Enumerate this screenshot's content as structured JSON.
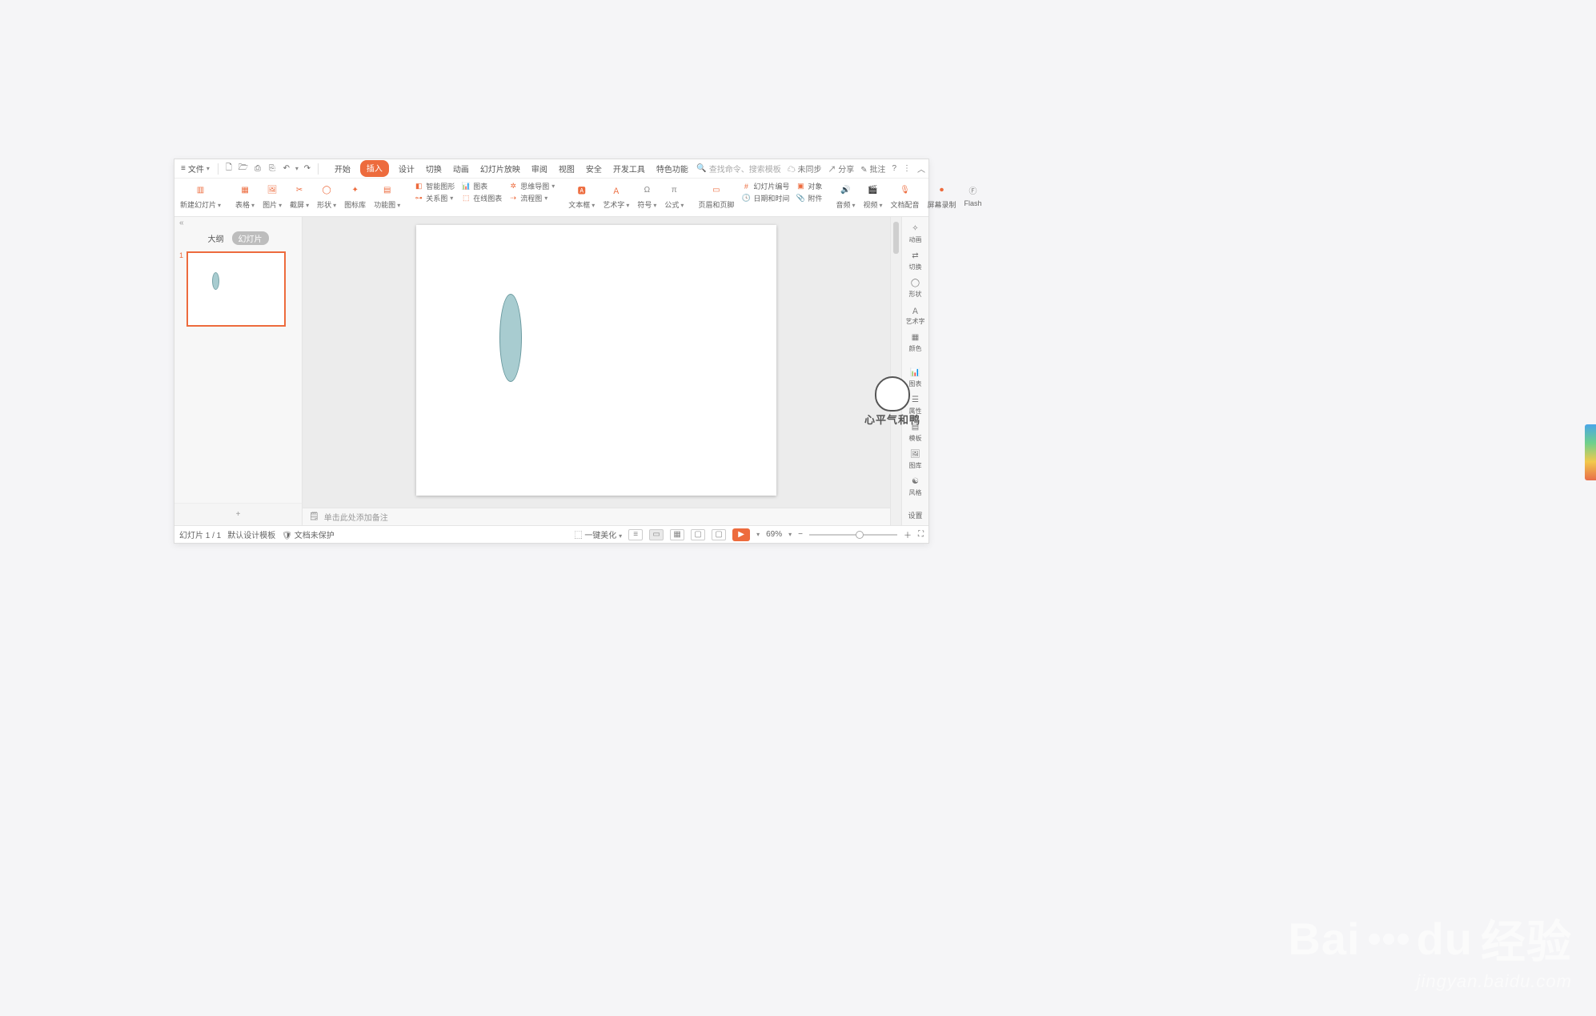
{
  "menu": {
    "file_label": "文件"
  },
  "quick_access": {
    "new": "新建",
    "open": "打开",
    "print": "打印",
    "save": "保存",
    "undo": "撤销",
    "redo": "重做"
  },
  "tabs": {
    "start": "开始",
    "insert": "插入",
    "design": "设计",
    "transition": "切换",
    "animation": "动画",
    "slideshow": "幻灯片放映",
    "review": "审阅",
    "view": "视图",
    "security": "安全",
    "devtools": "开发工具",
    "special": "特色功能"
  },
  "toolbar_right": {
    "search_placeholder": "查找命令、搜索模板",
    "unsynced": "未同步",
    "share": "分享",
    "annotate": "批注"
  },
  "ribbon": {
    "new_slide": "新建幻灯片",
    "table": "表格",
    "picture": "图片",
    "screenshot": "截屏",
    "shape": "形状",
    "icons": "图标库",
    "function_chart": "功能图",
    "smart_graphic": "智能图形",
    "chart": "图表",
    "relation": "关系图",
    "mindmap": "思维导图",
    "online_chart": "在线图表",
    "flowchart": "流程图",
    "textbox": "文本框",
    "wordart": "艺术字",
    "symbol": "符号",
    "formula": "公式",
    "header_footer": "页眉和页脚",
    "slide_number": "幻灯片编号",
    "object": "对象",
    "datetime": "日期和时间",
    "attachment": "附件",
    "audio": "音频",
    "video": "视频",
    "doc_voice": "文档配音",
    "screen_record": "屏幕录制",
    "flash": "Flash"
  },
  "side": {
    "outline_tab": "大纲",
    "slides_tab": "幻灯片",
    "slide_number": "1",
    "add_icon": "+"
  },
  "right_dock": {
    "animation": "动画",
    "transition": "切换",
    "shape": "形状",
    "wordart": "艺术字",
    "color": "颜色",
    "chart": "图表",
    "property": "属性",
    "template": "模板",
    "gallery": "图库",
    "style": "风格",
    "settings": "设置"
  },
  "notes": {
    "placeholder": "单击此处添加备注"
  },
  "status": {
    "slide_counter": "幻灯片 1 / 1",
    "template": "默认设计模板",
    "protect": "文档未保护",
    "beautify": "一键美化",
    "zoom": "69%"
  },
  "mascot": {
    "text": "心平气和鸭"
  },
  "watermark": {
    "brand": "Bai",
    "brand2": "du",
    "cn": "经验",
    "url": "jingyan.baidu.com"
  }
}
